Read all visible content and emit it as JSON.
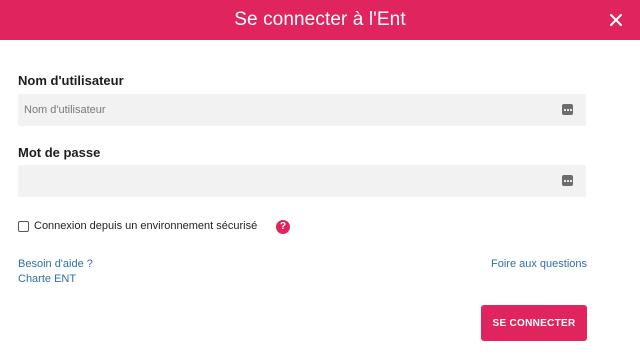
{
  "header": {
    "title": "Se connecter à l'Ent",
    "background_color": "#e0245e",
    "close_icon": "close-icon"
  },
  "form": {
    "username": {
      "label": "Nom d'utilisateur",
      "placeholder": "Nom d'utilisateur",
      "value": "",
      "icon": "password-dots-icon"
    },
    "password": {
      "label": "Mot de passe",
      "placeholder": "",
      "value": "",
      "icon": "password-dots-icon"
    },
    "secure_env": {
      "label": "Connexion depuis un environnement sécurisé",
      "checked": false,
      "help_icon_text": "?"
    }
  },
  "links": {
    "help": "Besoin d'aide ?",
    "charter": "Charte ENT",
    "faq": "Foire aux questions"
  },
  "actions": {
    "connect_label": "SE CONNECTER",
    "accent_color": "#e0245e"
  }
}
